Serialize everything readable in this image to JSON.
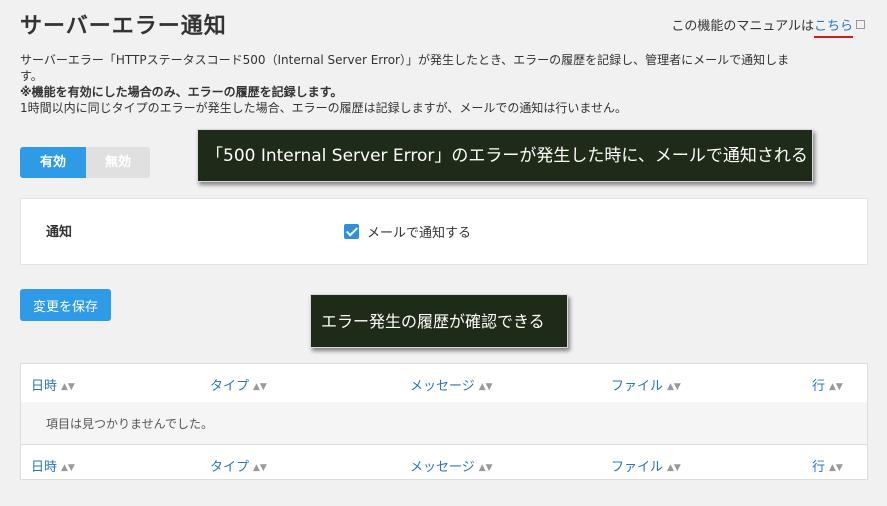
{
  "header": {
    "title": "サーバーエラー通知",
    "manual_prefix": "この機能のマニュアルは",
    "manual_link": "こちら"
  },
  "description": {
    "line1": "サーバーエラー「HTTPステータスコード500（Internal Server Error）」が発生したとき、エラーの履歴を記録し、管理者にメールで通知しま",
    "line1b": "す。",
    "line2": "※機能を有効にした場合のみ、エラーの履歴を記録します。",
    "line3": "1時間以内に同じタイプのエラーが発生した場合、エラーの履歴は記録しますが、メールでの通知は行いません。"
  },
  "toggle": {
    "on_label": "有効",
    "off_label": "無効",
    "selected": "on"
  },
  "notify_panel": {
    "label": "通知",
    "checkbox_label": "メールで通知する",
    "checked": true
  },
  "save_label": "変更を保存",
  "callouts": {
    "first": "「500 Internal Server Error」のエラーが発生した時に、メールで通知される",
    "second": "エラー発生の履歴が確認できる"
  },
  "table": {
    "columns": [
      "日時",
      "タイプ",
      "メッセージ",
      "ファイル",
      "行"
    ],
    "empty_message": "項目は見つかりませんでした。"
  },
  "colors": {
    "accent": "#2f9ae6",
    "callout_bg": "#1f2b19",
    "link": "#2a74b8"
  }
}
